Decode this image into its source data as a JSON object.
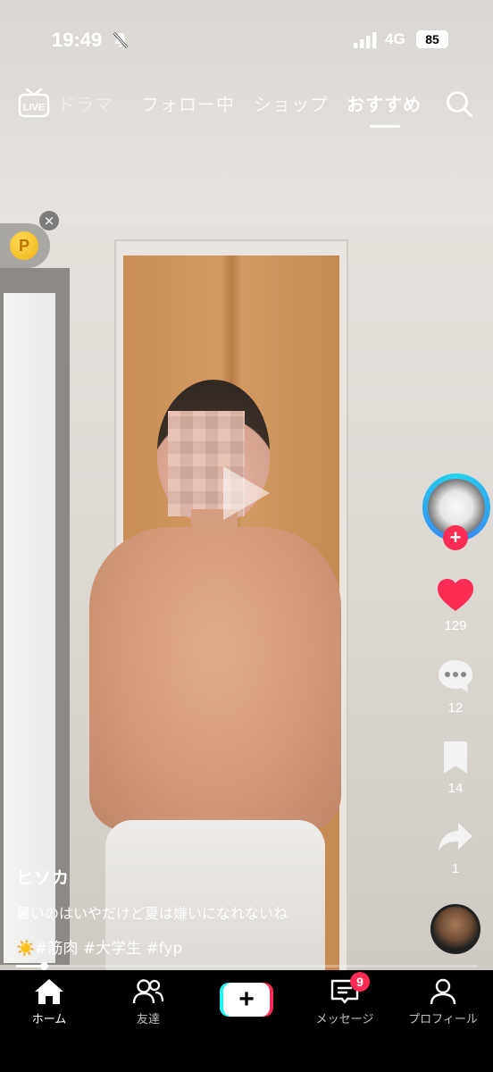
{
  "status_bar": {
    "time": "19:49",
    "network": "4G",
    "battery": "85"
  },
  "top_nav": {
    "live_label": "LIVE",
    "tabs": [
      {
        "label": "ドラマ"
      },
      {
        "label": "フォロー中"
      },
      {
        "label": "ショップ"
      },
      {
        "label": "おすすめ",
        "active": true
      }
    ]
  },
  "coin": {
    "letter": "P",
    "close": "×"
  },
  "video": {
    "username": "ヒソカ",
    "description": "暑いのはいやだけど夏は嫌いになれないね",
    "hashtag_sun": "☀️",
    "hashtags": "#筋肉 #大学生 #fyp",
    "progress": 0.06
  },
  "rail": {
    "follow_plus": "+",
    "likes": "129",
    "comments": "12",
    "saves": "14",
    "shares": "1"
  },
  "bottom_nav": {
    "home": "ホーム",
    "friends": "友達",
    "create": "+",
    "inbox": "メッセージ",
    "inbox_badge": "9",
    "profile": "プロフィール"
  },
  "colors": {
    "accent": "#fe2c55",
    "cyan": "#25f4ee"
  }
}
